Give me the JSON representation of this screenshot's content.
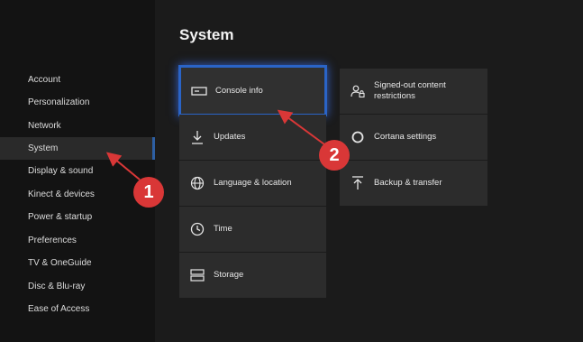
{
  "page": {
    "title": "System"
  },
  "sidebar": {
    "items": [
      {
        "label": "Account"
      },
      {
        "label": "Personalization"
      },
      {
        "label": "Network"
      },
      {
        "label": "System",
        "selected": true
      },
      {
        "label": "Display & sound"
      },
      {
        "label": "Kinect & devices"
      },
      {
        "label": "Power & startup"
      },
      {
        "label": "Preferences"
      },
      {
        "label": "TV & OneGuide"
      },
      {
        "label": "Disc & Blu-ray"
      },
      {
        "label": "Ease of Access"
      }
    ]
  },
  "tiles_left": [
    {
      "label": "Console info",
      "icon": "console-icon",
      "focused": true
    },
    {
      "label": "Updates",
      "icon": "download-icon"
    },
    {
      "label": "Language & location",
      "icon": "globe-icon"
    },
    {
      "label": "Time",
      "icon": "clock-icon"
    },
    {
      "label": "Storage",
      "icon": "storage-icon"
    }
  ],
  "tiles_right": [
    {
      "label": "Signed-out content restrictions",
      "icon": "user-lock-icon"
    },
    {
      "label": "Cortana settings",
      "icon": "cortana-icon"
    },
    {
      "label": "Backup & transfer",
      "icon": "upload-icon"
    }
  ],
  "annotations": {
    "marker1": "1",
    "marker2": "2",
    "color": "#d93737"
  },
  "colors": {
    "background": "#1b1b1b",
    "sidebar": "#131313",
    "tile": "#2c2c2c",
    "focus": "#2a64c7"
  }
}
